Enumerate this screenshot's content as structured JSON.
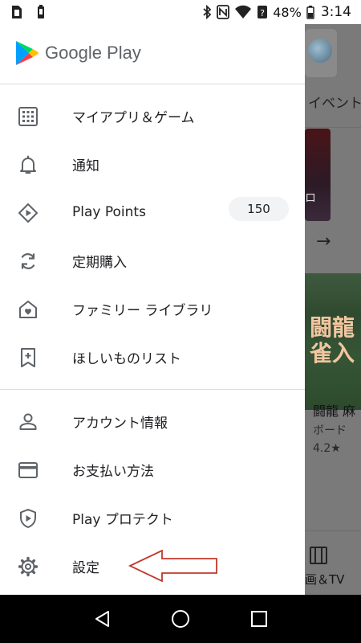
{
  "status_bar": {
    "battery_percent": "48%",
    "time": "3:14"
  },
  "drawer": {
    "brand": "Google Play",
    "items": [
      {
        "label": "マイアプリ＆ゲーム",
        "icon": "apps-grid-icon"
      },
      {
        "label": "通知",
        "icon": "bell-icon"
      },
      {
        "label": "Play Points",
        "icon": "play-points-icon",
        "badge": "150"
      },
      {
        "label": "定期購入",
        "icon": "refresh-icon"
      },
      {
        "label": "ファミリー ライブラリ",
        "icon": "family-heart-icon"
      },
      {
        "label": "ほしいものリスト",
        "icon": "bookmark-add-icon"
      },
      {
        "label": "アカウント情報",
        "icon": "person-icon"
      },
      {
        "label": "お支払い方法",
        "icon": "credit-card-icon"
      },
      {
        "label": "Play プロテクト",
        "icon": "shield-play-icon"
      },
      {
        "label": "設定",
        "icon": "gear-icon"
      }
    ]
  },
  "background": {
    "section_label": "イベント",
    "card_partial_text": "ロ",
    "game_title": "闘龍 麻",
    "game_category": "ボード",
    "game_rating": "4.2★",
    "mahjong_banner_title": "闘龍\n雀入",
    "bottom_tab_label": "画＆TV"
  },
  "colors": {
    "accent_arrow": "#c0392b",
    "drawer_bg": "#ffffff",
    "scrim": "#7a7a7a",
    "badge_bg": "#f1f3f4"
  }
}
